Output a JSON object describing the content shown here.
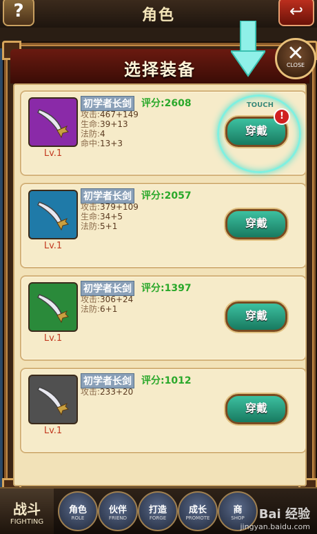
{
  "screen": {
    "title": "角色"
  },
  "top_buttons": {
    "help": "?",
    "back": "↩"
  },
  "dialog": {
    "title": "选择装备",
    "close_label": "CLOSE",
    "close_glyph": "✕"
  },
  "touch_hint": "TOUCH",
  "alert_glyph": "!",
  "items": [
    {
      "name": "初学者长剑",
      "score": "评分:2608",
      "level": "Lv.1",
      "rarity_color": "#8a2aa8",
      "stats": [
        {
          "k": "攻击:",
          "v": "467+149"
        },
        {
          "k": "生命:",
          "v": "39+13"
        },
        {
          "k": "法防:",
          "v": "4"
        },
        {
          "k": "命中:",
          "v": "13+3"
        }
      ],
      "button": "穿戴"
    },
    {
      "name": "初学者长剑",
      "score": "评分:2057",
      "level": "Lv.1",
      "rarity_color": "#1f7aa8",
      "stats": [
        {
          "k": "攻击:",
          "v": "379+109"
        },
        {
          "k": "生命:",
          "v": "34+5"
        },
        {
          "k": "法防:",
          "v": "5+1"
        }
      ],
      "button": "穿戴"
    },
    {
      "name": "初学者长剑",
      "score": "评分:1397",
      "level": "Lv.1",
      "rarity_color": "#2a8a3a",
      "stats": [
        {
          "k": "攻击:",
          "v": "306+24"
        },
        {
          "k": "法防:",
          "v": "6+1"
        }
      ],
      "button": "穿戴"
    },
    {
      "name": "初学者长剑",
      "score": "评分:1012",
      "level": "Lv.1",
      "rarity_color": "#505050",
      "stats": [
        {
          "k": "攻击:",
          "v": "233+20"
        }
      ],
      "button": "穿戴"
    }
  ],
  "bottom_nav": {
    "fight": {
      "zh": "战斗",
      "en": "FIGHTING"
    },
    "items": [
      {
        "zh": "角色",
        "en": "ROLE"
      },
      {
        "zh": "伙伴",
        "en": "FRIEND"
      },
      {
        "zh": "打造",
        "en": "FORGE"
      },
      {
        "zh": "成长",
        "en": "PROMOTE"
      },
      {
        "zh": "商",
        "en": "SHOP"
      }
    ]
  },
  "watermark": {
    "brand": "Bai 经验",
    "url": "jingyan.baidu.com"
  }
}
